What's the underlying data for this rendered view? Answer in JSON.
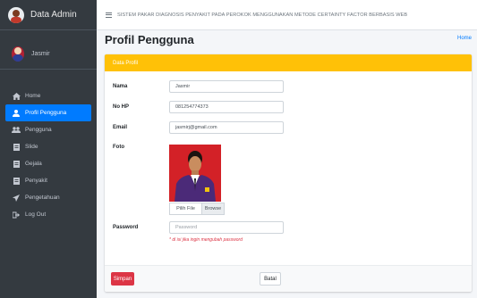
{
  "brand": {
    "name": "Data Admin"
  },
  "topbar": {
    "app_title": "SISTEM PAKAR DIAGNOSIS PENYAKIT PADA PEROKOK MENGGUNAKAN METODE CERTAINTY FACTOR BERBASIS WEB"
  },
  "user": {
    "name": "Jasmir"
  },
  "sidebar": {
    "items": [
      {
        "label": "Home",
        "icon": "home-icon"
      },
      {
        "label": "Profil Pengguna",
        "icon": "user-icon",
        "active": true
      },
      {
        "label": "Pengguna",
        "icon": "users-icon"
      },
      {
        "label": "Slide",
        "icon": "file-icon"
      },
      {
        "label": "Gejala",
        "icon": "file-icon"
      },
      {
        "label": "Penyakit",
        "icon": "file-icon"
      },
      {
        "label": "Pengetahuan",
        "icon": "paper-plane-icon"
      },
      {
        "label": "Log Out",
        "icon": "sign-out-icon"
      }
    ]
  },
  "page": {
    "title": "Profil Pengguna",
    "breadcrumb": "Home"
  },
  "card": {
    "header": "Data Profil"
  },
  "form": {
    "nama": {
      "label": "Nama",
      "value": "Jasmir"
    },
    "nohp": {
      "label": "No HP",
      "value": "081254774373"
    },
    "email": {
      "label": "Email",
      "value": "jasmirj@gmail.com"
    },
    "foto": {
      "label": "Foto",
      "choose_label": "Pilih File",
      "browse_label": "Browse"
    },
    "password": {
      "label": "Password",
      "placeholder": "Password",
      "hint": "* di isi jika ingin mengubah password"
    }
  },
  "buttons": {
    "save": "Simpan",
    "cancel": "Batal"
  },
  "colors": {
    "sidebar_bg": "#343a40",
    "active": "#007bff",
    "card_header": "#ffc107",
    "save": "#dc3545"
  }
}
